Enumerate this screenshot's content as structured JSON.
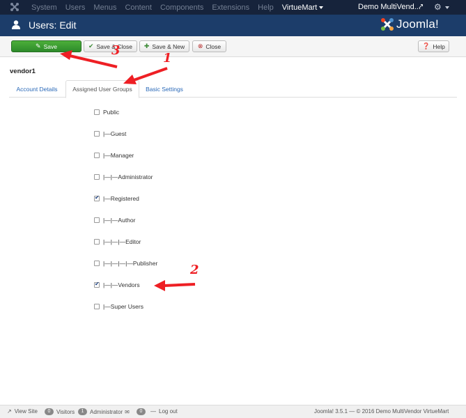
{
  "topbar": {
    "menu": [
      "System",
      "Users",
      "Menus",
      "Content",
      "Components",
      "Extensions",
      "Help"
    ],
    "virtuemart": "VirtueMart",
    "site_name": "Demo MultiVend..."
  },
  "header": {
    "title": "Users: Edit",
    "brand": "Joomla!"
  },
  "toolbar": {
    "save": "Save",
    "save_close": "Save & Close",
    "save_new": "Save & New",
    "close": "Close",
    "help": "Help"
  },
  "page": {
    "username": "vendor1",
    "tabs": [
      "Account Details",
      "Assigned User Groups",
      "Basic Settings"
    ],
    "active_tab": "Assigned User Groups"
  },
  "groups": [
    {
      "label": "Public",
      "checked": false
    },
    {
      "label": "|—Guest",
      "checked": false
    },
    {
      "label": "|—Manager",
      "checked": false
    },
    {
      "label": "|—|—Administrator",
      "checked": false
    },
    {
      "label": "|—Registered",
      "checked": true
    },
    {
      "label": "|—|—Author",
      "checked": false
    },
    {
      "label": "|—|—|—Editor",
      "checked": false
    },
    {
      "label": "|—|—|—|—Publisher",
      "checked": false
    },
    {
      "label": "|—|—Vendors",
      "checked": true
    },
    {
      "label": "|—Super Users",
      "checked": false
    }
  ],
  "annotations": [
    "1",
    "2",
    "3"
  ],
  "footer": {
    "view_site": "View Site",
    "visitors_count": "0",
    "visitors": "Visitors",
    "admin_count": "1",
    "administrator": "Administrator",
    "messages_count": "0",
    "logout": "Log out",
    "copyright": "Joomla! 3.5.1  —  © 2016 Demo MultiVendor VirtueMart"
  },
  "colors": {
    "topbar": "#16233b",
    "header": "#1c3d6a",
    "save_button": "#2d8a2a",
    "link": "#2a69b8",
    "annotation": "#ee1f24"
  }
}
